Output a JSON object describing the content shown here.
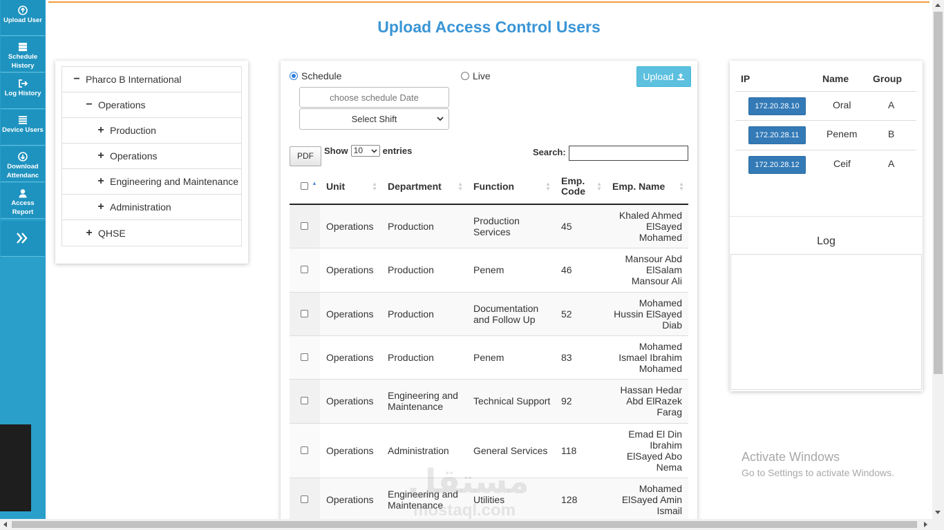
{
  "page": {
    "title": "Upload Access Control Users"
  },
  "sidebar": {
    "items": [
      {
        "label": "Upload User",
        "icon": "upload-circle-icon"
      },
      {
        "label": "Schedule History",
        "icon": "server-icon"
      },
      {
        "label": "Log History",
        "icon": "sign-out-icon"
      },
      {
        "label": "Device Users",
        "icon": "list-icon"
      },
      {
        "label": "Download Attendanc",
        "icon": "download-circle-icon"
      },
      {
        "label": "Access Report",
        "icon": "user-icon"
      }
    ],
    "expand_icon": "double-chevron-right-icon"
  },
  "tree": {
    "nodes": [
      {
        "label": "Pharco B International",
        "sign": "−",
        "level": 0
      },
      {
        "label": "Operations",
        "sign": "−",
        "level": 1
      },
      {
        "label": "Production",
        "sign": "+",
        "level": 2
      },
      {
        "label": "Operations",
        "sign": "+",
        "level": 2
      },
      {
        "label": "Engineering and Maintenance",
        "sign": "+",
        "level": 2
      },
      {
        "label": "Administration",
        "sign": "+",
        "level": 2
      },
      {
        "label": "QHSE",
        "sign": "+",
        "level": 1
      }
    ]
  },
  "schedule": {
    "mode_schedule": "Schedule",
    "mode_live": "Live",
    "selected_mode": "Schedule",
    "upload_label": "Upload",
    "date_placeholder": "choose schedule Date",
    "shift_value": "Select Shift"
  },
  "table_controls": {
    "pdf_label": "PDF",
    "show_label": "Show",
    "entries_value": "10",
    "entries_label": "entries",
    "search_label": "Search:"
  },
  "table": {
    "headers": [
      "Unit",
      "Department",
      "Function",
      "Emp. Code",
      "Emp. Name"
    ],
    "rows": [
      {
        "unit": "Operations",
        "department": "Production",
        "function": "Production Services",
        "code": "45",
        "name": "Khaled Ahmed ElSayed Mohamed"
      },
      {
        "unit": "Operations",
        "department": "Production",
        "function": "Penem",
        "code": "46",
        "name": "Mansour Abd ElSalam Mansour Ali"
      },
      {
        "unit": "Operations",
        "department": "Production",
        "function": "Documentation and Follow Up",
        "code": "52",
        "name": "Mohamed Hussin ElSayed Diab"
      },
      {
        "unit": "Operations",
        "department": "Production",
        "function": "Penem",
        "code": "83",
        "name": "Mohamed Ismael Ibrahim Mohamed"
      },
      {
        "unit": "Operations",
        "department": "Engineering and Maintenance",
        "function": "Technical Support",
        "code": "92",
        "name": "Hassan Hedar Abd ElRazek Farag"
      },
      {
        "unit": "Operations",
        "department": "Administration",
        "function": "General Services",
        "code": "118",
        "name": "Emad El Din Ibrahim ElSayed Abo Nema"
      },
      {
        "unit": "Operations",
        "department": "Engineering and Maintenance",
        "function": "Utilities",
        "code": "128",
        "name": "Mohamed ElSayed Amin Ismail"
      }
    ]
  },
  "devices": {
    "headers": {
      "ip": "IP",
      "name": "Name",
      "group": "Group"
    },
    "rows": [
      {
        "ip": "172.20.28.10",
        "name": "Oral",
        "group": "A"
      },
      {
        "ip": "172.20.28.11",
        "name": "Penem",
        "group": "B"
      },
      {
        "ip": "172.20.28.12",
        "name": "Ceif",
        "group": "A"
      }
    ]
  },
  "log": {
    "title": "Log"
  },
  "overlay": {
    "activate_title": "Activate Windows",
    "activate_sub": "Go to Settings to activate Windows.",
    "watermark": "مستقل",
    "watermark_url": "mostaql.com"
  },
  "colors": {
    "sidebar": "#2a9fc9",
    "title": "#3a95d6",
    "accent_rule": "#f39c3a",
    "upload_button": "#5cc0de",
    "ip_button": "#337ab7"
  }
}
